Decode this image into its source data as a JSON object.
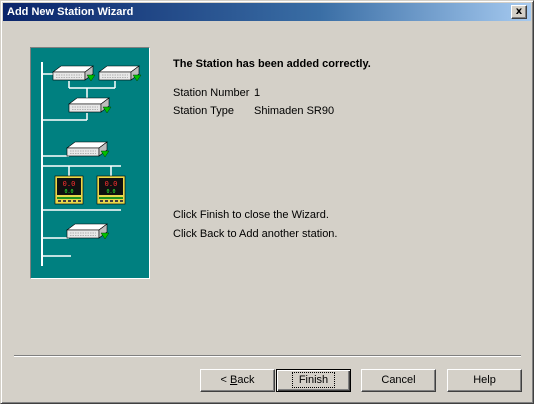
{
  "window": {
    "title": "Add New Station Wizard",
    "close_glyph": "x"
  },
  "main": {
    "heading": "The Station has been added correctly.",
    "station_number_label": "Station Number",
    "station_number_value": "1",
    "station_type_label": "Station Type",
    "station_type_value": "Shimaden SR90",
    "note_finish": "Click Finish to close the Wizard.",
    "note_back": "Click Back to Add another station."
  },
  "illustration": {
    "background_color": "#008080",
    "device_display_text": "0.0",
    "icons": [
      "network-bus-icon",
      "controller-device-icon",
      "panel-meter-icon"
    ]
  },
  "buttons": {
    "back_prefix": "< ",
    "back_accel": "B",
    "back_rest": "ack",
    "finish": "Finish",
    "cancel": "Cancel",
    "help": "Help"
  }
}
